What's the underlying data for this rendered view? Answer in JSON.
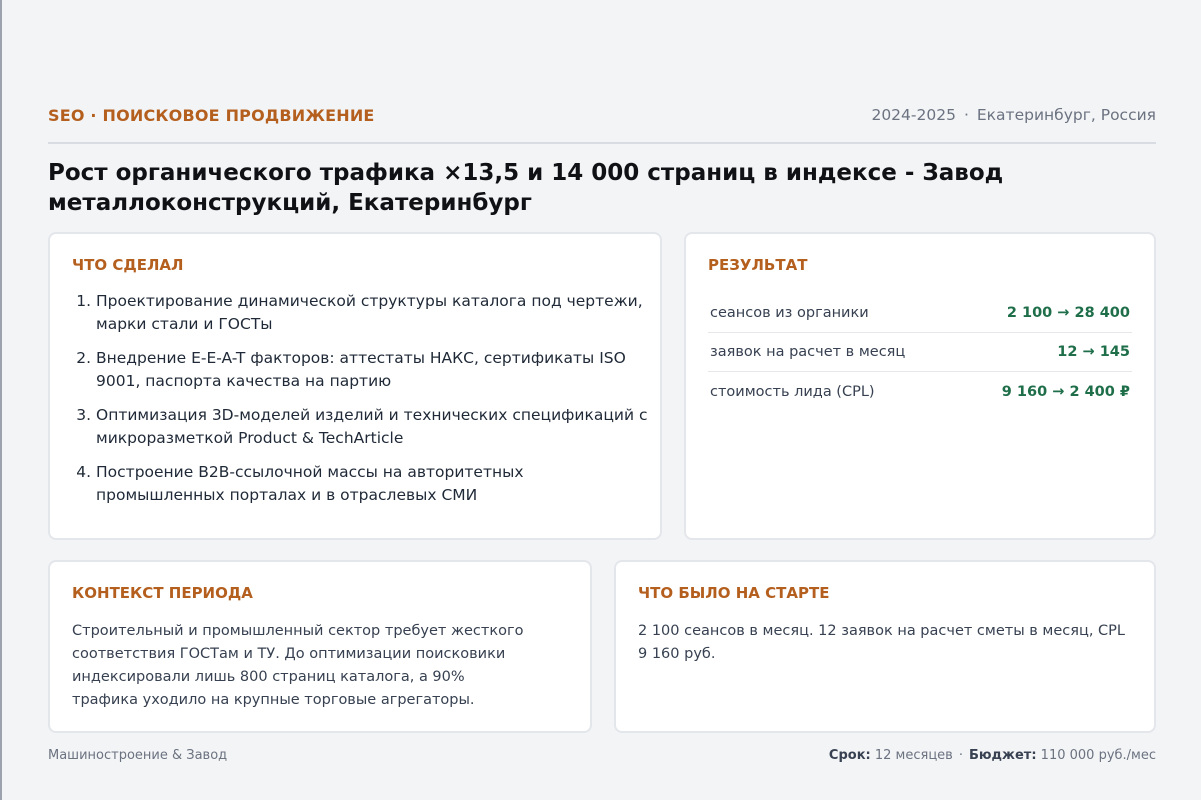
{
  "header": {
    "category": "SEO · ПОИСКОВОЕ ПРОДВИЖЕНИЕ",
    "years": "2024-2025",
    "separator": "·",
    "location": "Екатеринбург, Россия"
  },
  "title": "Рост органического трафика ×13,5 и 14 000 страниц в индексе - Завод металлоконструкций, Екатеринбург",
  "did": {
    "heading": "ЧТО СДЕЛАЛ",
    "items": [
      "Проектирование динамической структуры каталога под чертежи, марки стали и ГОСТы",
      "Внедрение E-E-A-T факторов: аттестаты НАКС, сертификаты ISO 9001, паспорта качества на партию",
      "Оптимизация 3D-моделей изделий и технических спецификаций с микроразметкой Product & TechArticle",
      "Построение B2B-ссылочной массы на авторитетных промышленных порталах и в отраслевых СМИ"
    ]
  },
  "result": {
    "heading": "РЕЗУЛЬТАТ",
    "rows": [
      {
        "label": "сеансов из органики",
        "value": "2 100 → 28 400"
      },
      {
        "label": "заявок на расчет в месяц",
        "value": "12 → 145"
      },
      {
        "label": "стоимость лида (CPL)",
        "value": "9 160 → 2 400 ₽"
      }
    ]
  },
  "context": {
    "heading": "КОНТЕКСТ ПЕРИОДА",
    "text": "Строительный и промышленный сектор требует жесткого соответствия ГОСТам и ТУ. До оптимизации поисковики индексировали лишь 800 страниц каталога, а 90% трафика уходило на крупные торговые агрегаторы."
  },
  "start": {
    "heading": "ЧТО БЫЛО НА СТАРТЕ",
    "text": "2 100 сеансов в месяц. 12 заявок на расчет сметы в месяц, CPL 9 160 руб."
  },
  "footer": {
    "industry": "Машиностроение & Завод",
    "term_label": "Срок:",
    "term_value": "12 месяцев",
    "separator": "·",
    "budget_label": "Бюджет:",
    "budget_value": "110 000 руб./мес"
  },
  "colors": {
    "accent": "#b45f1e",
    "result_value": "#1f6e4a",
    "background": "#f3f4f6"
  }
}
